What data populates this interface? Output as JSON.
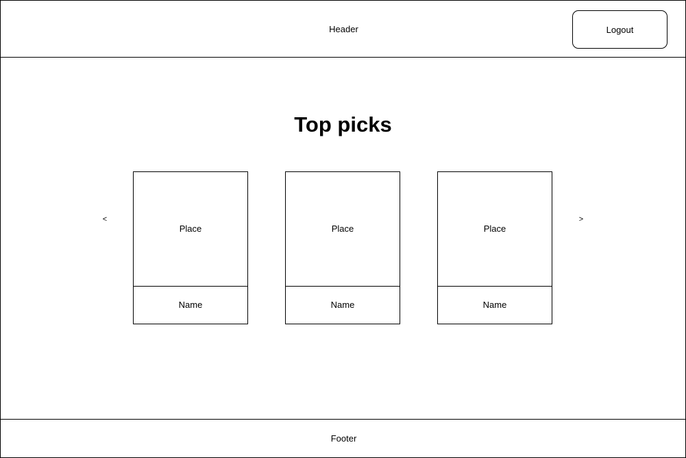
{
  "header": {
    "title": "Header",
    "logout_label": "Logout"
  },
  "main": {
    "title": "Top picks",
    "prev_label": "<",
    "next_label": ">",
    "cards": [
      {
        "place": "Place",
        "name": "Name"
      },
      {
        "place": "Place",
        "name": "Name"
      },
      {
        "place": "Place",
        "name": "Name"
      }
    ]
  },
  "footer": {
    "text": "Footer"
  }
}
